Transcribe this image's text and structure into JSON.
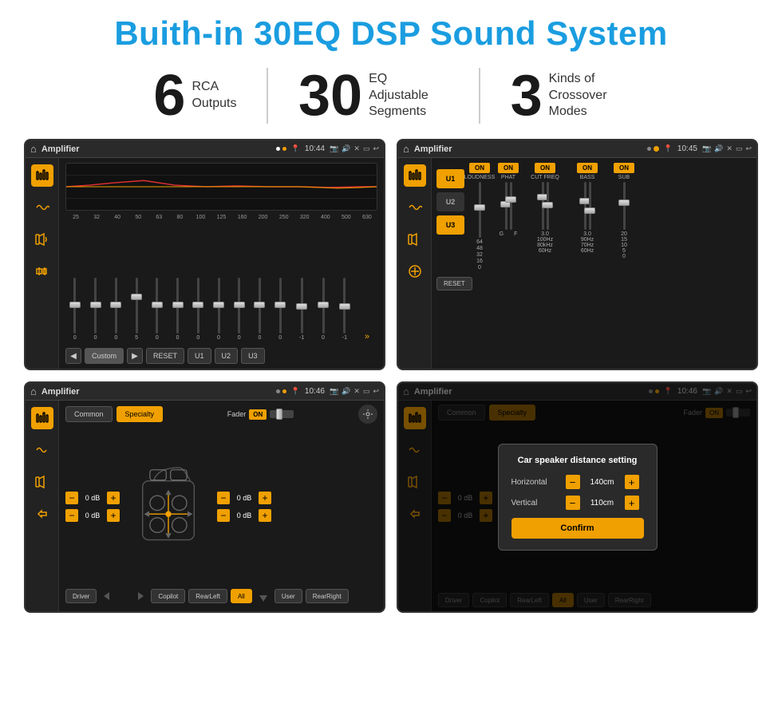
{
  "page": {
    "title": "Buith-in 30EQ DSP Sound System",
    "stats": [
      {
        "number": "6",
        "label": "RCA\nOutputs"
      },
      {
        "number": "30",
        "label": "EQ Adjustable\nSegments"
      },
      {
        "number": "3",
        "label": "Kinds of\nCrossover Modes"
      }
    ]
  },
  "screens": {
    "eq": {
      "title": "Amplifier",
      "time": "10:44",
      "freqs": [
        "25",
        "32",
        "40",
        "50",
        "63",
        "80",
        "100",
        "125",
        "160",
        "200",
        "250",
        "320",
        "400",
        "500",
        "630"
      ],
      "values": [
        "0",
        "0",
        "0",
        "5",
        "0",
        "0",
        "0",
        "0",
        "0",
        "0",
        "0",
        "0",
        "0",
        "-1",
        "0",
        "-1"
      ],
      "buttons": [
        "Custom",
        "RESET",
        "U1",
        "U2",
        "U3"
      ]
    },
    "crossover": {
      "title": "Amplifier",
      "time": "10:45",
      "presets": [
        "U1",
        "U2",
        "U3"
      ],
      "toggles": [
        "LOUDNESS",
        "PHAT",
        "CUT FREQ",
        "BASS",
        "SUB"
      ],
      "reset": "RESET"
    },
    "fader": {
      "title": "Amplifier",
      "time": "10:46",
      "tabs": [
        "Common",
        "Specialty"
      ],
      "fader_label": "Fader",
      "on_label": "ON",
      "values": [
        "0 dB",
        "0 dB",
        "0 dB",
        "0 dB"
      ],
      "buttons": [
        "Driver",
        "Copilot",
        "RearLeft",
        "All",
        "User",
        "RearRight"
      ]
    },
    "distance": {
      "title": "Amplifier",
      "time": "10:46",
      "tabs": [
        "Common",
        "Specialty"
      ],
      "modal": {
        "title": "Car speaker distance setting",
        "rows": [
          {
            "label": "Horizontal",
            "value": "140cm"
          },
          {
            "label": "Vertical",
            "value": "110cm"
          }
        ],
        "confirm": "Confirm"
      },
      "values": [
        "0 dB",
        "0 dB"
      ],
      "buttons": [
        "Driver",
        "Copilot",
        "RearLeft",
        "All",
        "User",
        "RearRight"
      ]
    }
  },
  "icons": {
    "home": "⌂",
    "back": "↩",
    "location": "📍",
    "camera": "📷",
    "volume": "🔊",
    "x": "✕",
    "window": "▭",
    "eq_icon": "≋",
    "wave_icon": "∿",
    "speaker_icon": "◈"
  }
}
